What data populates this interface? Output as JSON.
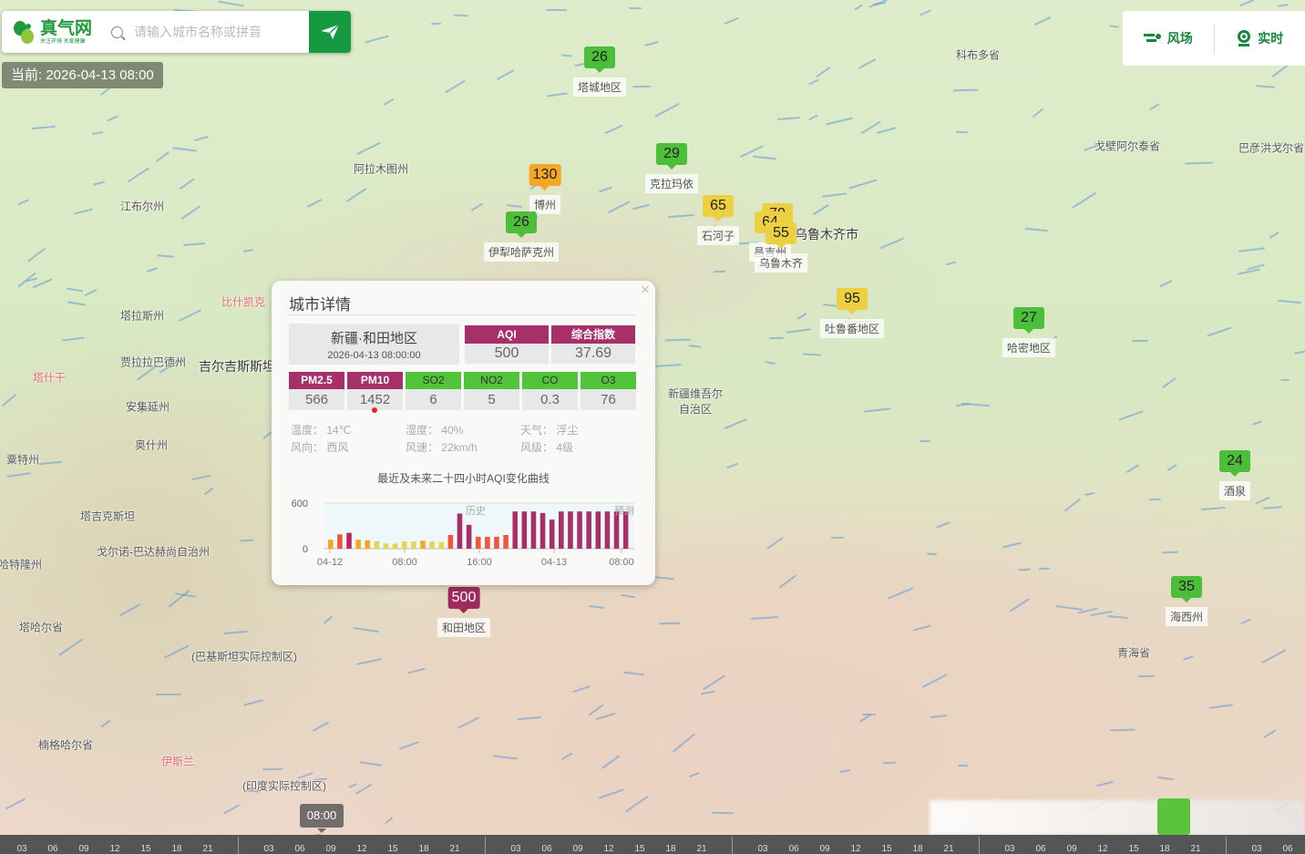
{
  "header": {
    "logo_text": "真气网",
    "logo_slogan": "关注环境 关爱健康",
    "search_placeholder": "请输入城市名称或拼音",
    "current_time": "当前: 2026-04-13 08:00"
  },
  "tools": [
    {
      "label": "风场",
      "icon": "wind-icon"
    },
    {
      "label": "实时",
      "icon": "camera-icon"
    }
  ],
  "markers": [
    {
      "value": "26",
      "label": "塔城地区",
      "color": "#4cbe3a"
    },
    {
      "value": "29",
      "label": "克拉玛依",
      "color": "#4cbe3a"
    },
    {
      "value": "130",
      "label": "博州",
      "color": "#f5a623"
    },
    {
      "value": "26",
      "label": "伊犁哈萨克州",
      "color": "#4cbe3a"
    },
    {
      "value": "65",
      "label": "石河子",
      "color": "#ecd041"
    },
    {
      "value": "70",
      "label": "",
      "color": "#ecd041"
    },
    {
      "value": "64",
      "label": "昌吉州",
      "color": "#ecd041"
    },
    {
      "value": "55",
      "label": "乌鲁木齐",
      "color": "#ecd041"
    },
    {
      "value": "95",
      "label": "吐鲁番地区",
      "color": "#ecd041"
    },
    {
      "value": "27",
      "label": "哈密地区",
      "color": "#4cbe3a"
    },
    {
      "value": "24",
      "label": "酒泉",
      "color": "#4cbe3a"
    },
    {
      "value": "35",
      "label": "海西州",
      "color": "#4cbe3a"
    },
    {
      "value": "500",
      "label": "和田地区",
      "color": "#9e2a5e"
    }
  ],
  "places": [
    {
      "name": "科布多省"
    },
    {
      "name": "戈壁阿尔泰省"
    },
    {
      "name": "巴彦洪戈尔省"
    },
    {
      "name": "阿拉木图州"
    },
    {
      "name": "江布尔州"
    },
    {
      "name": "乌鲁木齐市"
    },
    {
      "name": "比什凯克"
    },
    {
      "name": "塔拉斯州"
    },
    {
      "name": "贾拉拉巴德州"
    },
    {
      "name": "吉尔吉斯斯坦"
    },
    {
      "name": "塔什干"
    },
    {
      "name": "安集延州"
    },
    {
      "name": "新疆维吾尔自治区"
    },
    {
      "name": "奥什州"
    },
    {
      "name": "塔吉克斯坦"
    },
    {
      "name": "戈尔诺-巴达赫尚自治州"
    },
    {
      "name": "青海省"
    },
    {
      "name": "(巴基斯坦实际控制区)"
    },
    {
      "name": "(印度实际控制区)"
    },
    {
      "name": "楠格哈尔省"
    },
    {
      "name": "伊斯兰"
    },
    {
      "name": "塔哈尔省"
    },
    {
      "name": "哈特隆州"
    },
    {
      "name": "粟特州"
    }
  ],
  "popup": {
    "title": "城市详情",
    "close": "×",
    "city": "新疆·和田地区",
    "datetime": "2026-04-13 08:00:00",
    "aqi_label": "AQI",
    "aqi": "500",
    "index_label": "综合指数",
    "index": "37.69",
    "pollutants": [
      {
        "name": "PM2.5",
        "value": "566",
        "color": "#a8306a"
      },
      {
        "name": "PM10",
        "value": "1452",
        "color": "#a8306a"
      },
      {
        "name": "SO2",
        "value": "6",
        "color": "#52c43a"
      },
      {
        "name": "NO2",
        "value": "5",
        "color": "#52c43a"
      },
      {
        "name": "CO",
        "value": "0.3",
        "color": "#52c43a"
      },
      {
        "name": "O3",
        "value": "76",
        "color": "#52c43a"
      }
    ],
    "weather": {
      "temp": "温度： 14℃",
      "humidity": "湿度： 40%",
      "weather": "天气： 浮尘",
      "wind_dir": "风向： 西风",
      "wind_speed": "风速： 22km/h",
      "wind_level": "风级： 4级"
    },
    "chart_title": "最近及未来二十四小时AQI变化曲线"
  },
  "chart_data": {
    "type": "bar",
    "title": "最近及未来二十四小时AQI变化曲线",
    "ylim": [
      0,
      600
    ],
    "yticks": [
      "0",
      "600"
    ],
    "xticks": [
      "04-12",
      "08:00",
      "16:00",
      "04-13",
      "08:00"
    ],
    "annotations": [
      "历史",
      "预测"
    ],
    "values": [
      118,
      188,
      208,
      118,
      110,
      98,
      67,
      67,
      94,
      94,
      106,
      94,
      86,
      180,
      463,
      314,
      157,
      157,
      157,
      180,
      490,
      490,
      490,
      470,
      384,
      490,
      490,
      490,
      490,
      490,
      490,
      490,
      490
    ]
  },
  "timeline": {
    "current": "08:00",
    "hours": [
      "03",
      "06",
      "09",
      "12",
      "15",
      "18",
      "21"
    ],
    "days": 6
  }
}
